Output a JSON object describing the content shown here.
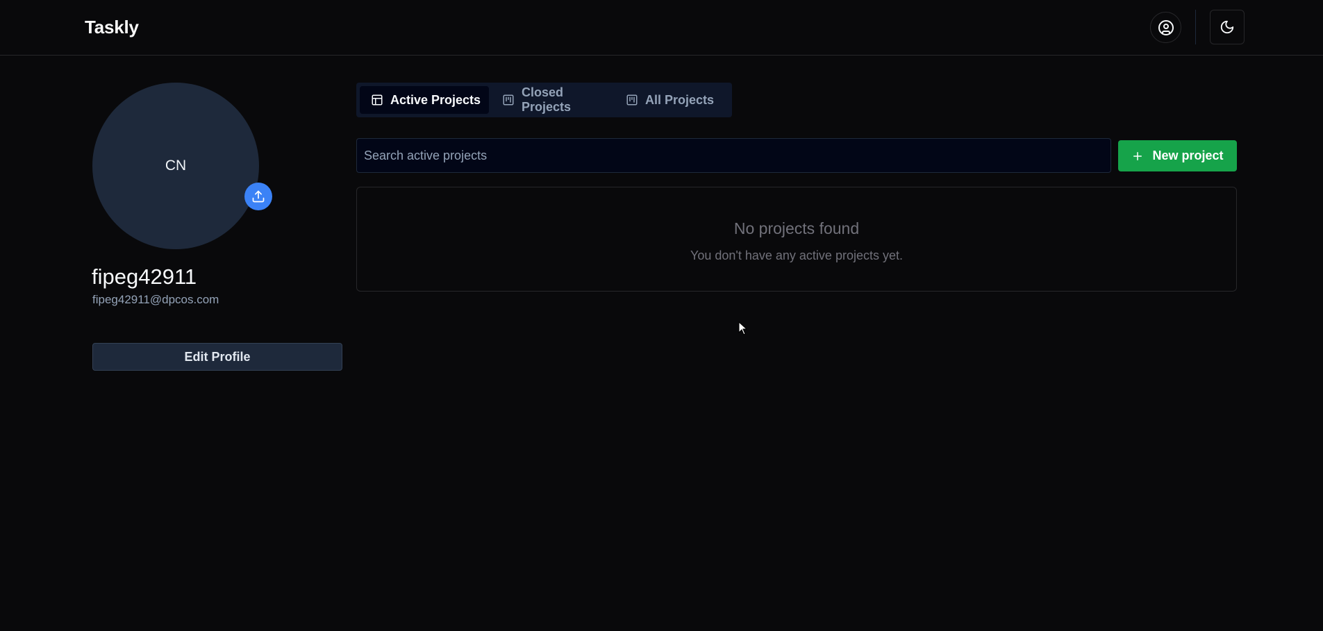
{
  "app": {
    "brand": "Taskly"
  },
  "header": {
    "user_icon": "user-circle-icon",
    "theme_icon": "moon-icon"
  },
  "profile": {
    "initials": "CN",
    "username": "fipeg42911",
    "email": "fipeg42911@dpcos.com",
    "edit_label": "Edit Profile",
    "upload_icon": "upload-icon"
  },
  "tabs": [
    {
      "label": "Active Projects",
      "icon": "layout-icon",
      "active": true
    },
    {
      "label": "Closed Projects",
      "icon": "kanban-icon",
      "active": false
    },
    {
      "label": "All Projects",
      "icon": "kanban-icon",
      "active": false
    }
  ],
  "search": {
    "placeholder": "Search active projects",
    "value": ""
  },
  "new_project": {
    "label": "New project",
    "icon": "plus-icon"
  },
  "empty_state": {
    "title": "No projects found",
    "subtitle": "You don't have any active projects yet."
  },
  "colors": {
    "background": "#09090b",
    "accent_green": "#16a34a",
    "accent_blue": "#3b82f6",
    "avatar_bg": "#1e293b"
  }
}
